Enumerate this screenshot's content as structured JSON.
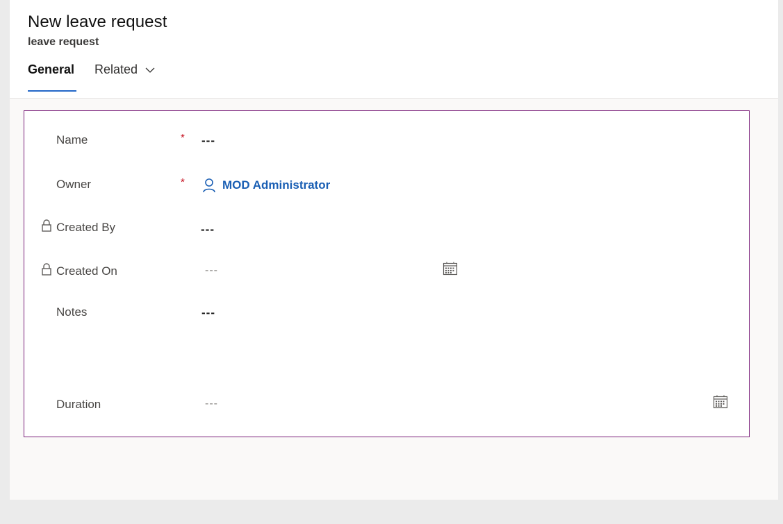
{
  "header": {
    "title": "New leave request",
    "subtitle": "leave request"
  },
  "tabs": {
    "general": "General",
    "related": "Related"
  },
  "form": {
    "name": {
      "label": "Name",
      "required_mark": "*",
      "value": "---"
    },
    "owner": {
      "label": "Owner",
      "required_mark": "*",
      "value": "MOD Administrator"
    },
    "created_by": {
      "label": "Created By",
      "value": "---"
    },
    "created_on": {
      "label": "Created On",
      "value": "---"
    },
    "notes": {
      "label": "Notes",
      "value": "---"
    },
    "duration": {
      "label": "Duration",
      "value": "---"
    }
  },
  "icons": {
    "lock": "lock-icon",
    "person": "person-icon",
    "calendar": "calendar-icon",
    "chevron": "chevron-down-icon"
  },
  "colors": {
    "accent": "#2266c7",
    "link": "#1a5fb4",
    "required": "#c50f1f",
    "focus_border": "#7a1e7a"
  }
}
